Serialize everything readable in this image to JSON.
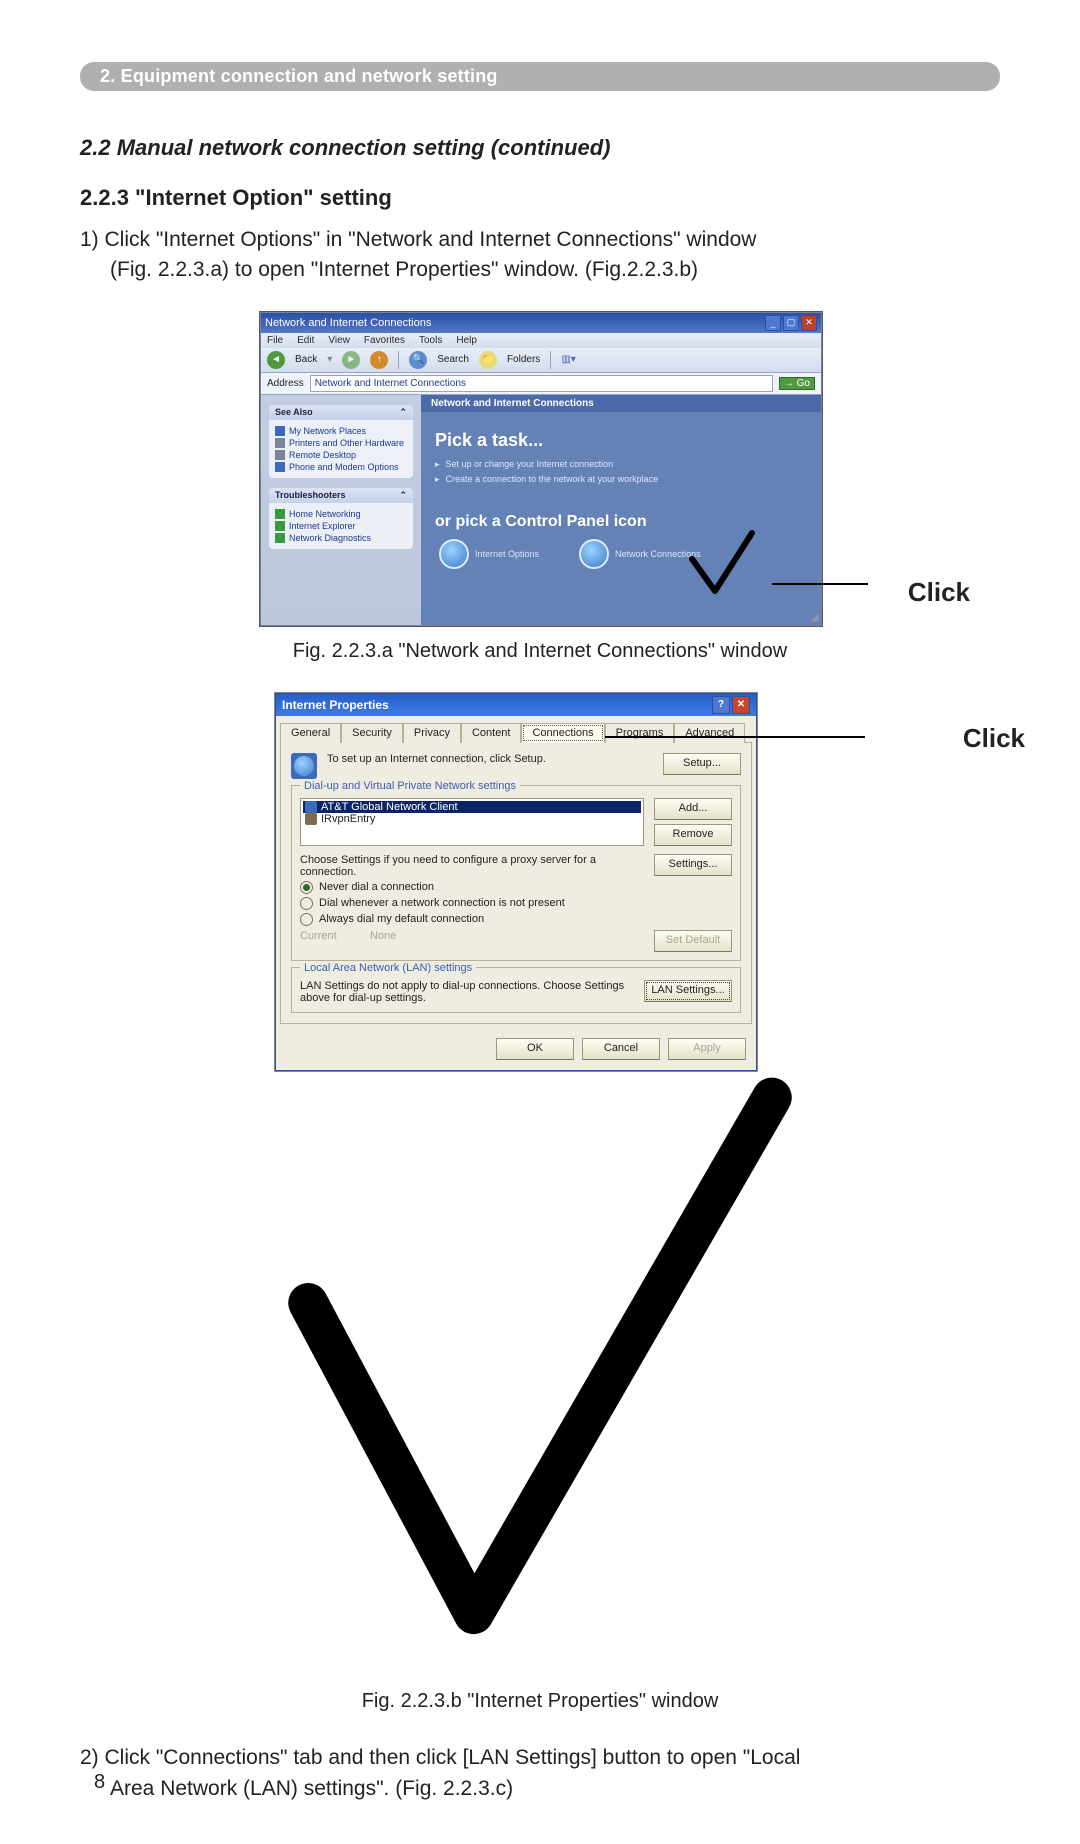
{
  "chapter_bar": "2. Equipment connection and network setting",
  "sub_heading": "2.2 Manual network connection setting (continued)",
  "section_heading": "2.2.3 \"Internet Option\" setting",
  "step1_line1": "1) Click \"Internet Options\" in \"Network and Internet Connections\" window",
  "step1_line2": "(Fig. 2.2.3.a) to open \"Internet Properties\" window. (Fig.2.2.3.b)",
  "step2_line1": "2) Click \"Connections\" tab and then click [LAN Settings] button to open \"Local",
  "step2_line2": "Area Network (LAN) settings\". (Fig. 2.2.3.c)",
  "figA_caption": "Fig. 2.2.3.a \"Network and Internet Connections\" window",
  "figB_caption": "Fig. 2.2.3.b \"Internet Properties\" window",
  "callout_click": "Click",
  "page_number": "8",
  "figA": {
    "title": "Network and Internet Connections",
    "menu": {
      "file": "File",
      "edit": "Edit",
      "view": "View",
      "favorites": "Favorites",
      "tools": "Tools",
      "help": "Help"
    },
    "toolbar": {
      "back": "Back",
      "search": "Search",
      "folders": "Folders"
    },
    "addr_label": "Address",
    "addr_value": "Network and Internet Connections",
    "go": "Go",
    "side_seealso": "See Also",
    "side_items": {
      "a": "My Network Places",
      "b": "Printers and Other Hardware",
      "c": "Remote Desktop",
      "d": "Phone and Modem Options"
    },
    "side_trouble": "Troubleshooters",
    "side_t_items": {
      "a": "Home Networking",
      "b": "Internet Explorer",
      "c": "Network Diagnostics"
    },
    "mbar": "Network and Internet Connections",
    "pick_task": "Pick a task...",
    "task1": "Set up or change your Internet connection",
    "task2": "Create a connection to the network at your workplace",
    "or_pick": "or pick a Control Panel icon",
    "cp1": "Internet Options",
    "cp2": "Network Connections"
  },
  "figB": {
    "title": "Internet Properties",
    "tabs": {
      "general": "General",
      "security": "Security",
      "privacy": "Privacy",
      "content": "Content",
      "connections": "Connections",
      "programs": "Programs",
      "advanced": "Advanced"
    },
    "setup_text": "To set up an Internet connection, click Setup.",
    "btn_setup": "Setup...",
    "group_dialup": "Dial-up and Virtual Private Network settings",
    "list_sel": "AT&T Global Network Client",
    "list_item2": "IRvpnEntry",
    "btn_add": "Add...",
    "btn_remove": "Remove",
    "proxy_text": "Choose Settings if you need to configure a proxy server for a connection.",
    "btn_settings": "Settings...",
    "opt_never": "Never dial a connection",
    "opt_dialwhen": "Dial whenever a network connection is not present",
    "opt_always": "Always dial my default connection",
    "current_lbl": "Current",
    "current_val": "None",
    "btn_setdefault": "Set Default",
    "group_lan": "Local Area Network (LAN) settings",
    "lan_text": "LAN Settings do not apply to dial-up connections. Choose Settings above for dial-up settings.",
    "btn_lan": "LAN Settings...",
    "btn_ok": "OK",
    "btn_cancel": "Cancel",
    "btn_apply": "Apply"
  }
}
